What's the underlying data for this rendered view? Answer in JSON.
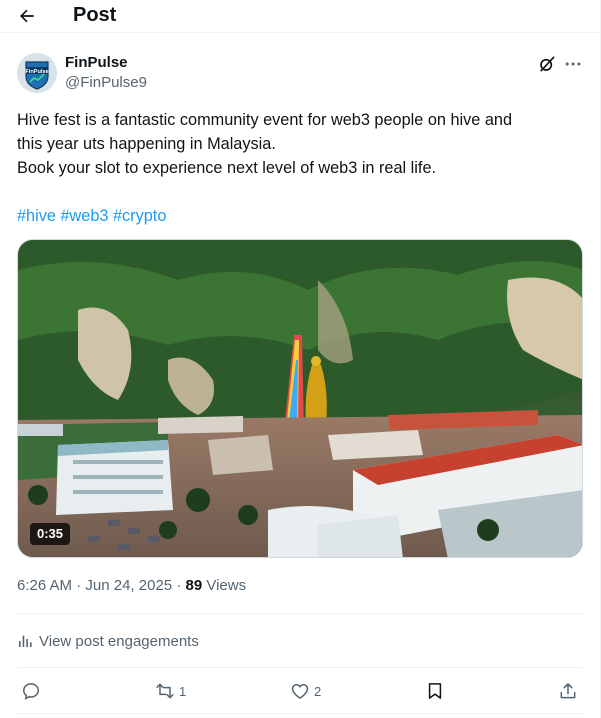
{
  "header": {
    "title": "Post"
  },
  "author": {
    "display_name": "FinPulse",
    "handle": "@FinPulse9",
    "avatar_text": "FinPulse"
  },
  "post": {
    "lines": [
      "Hive fest is a fantastic community event for web3 people on hive and",
      "this year uts happening in Malaysia.",
      "Book your slot to experience next level of web3 in real life."
    ],
    "hashtags": [
      "#hive",
      "#web3",
      "#crypto"
    ]
  },
  "media": {
    "duration": "0:35"
  },
  "meta": {
    "time": "6:26 AM",
    "separator": "·",
    "date": "Jun 24, 2025",
    "views_count": "89",
    "views_label": "Views"
  },
  "engagements": {
    "label": "View post engagements"
  },
  "actions": {
    "reply_count": "",
    "repost_count": "1",
    "like_count": "2"
  },
  "colors": {
    "accent": "#1d9bf0",
    "muted": "#536471",
    "text": "#0f1419",
    "border": "#eff3f4"
  },
  "icons": [
    "back-arrow-icon",
    "grok-icon",
    "more-icon",
    "analytics-icon",
    "reply-icon",
    "repost-icon",
    "like-icon",
    "bookmark-icon",
    "share-icon"
  ]
}
